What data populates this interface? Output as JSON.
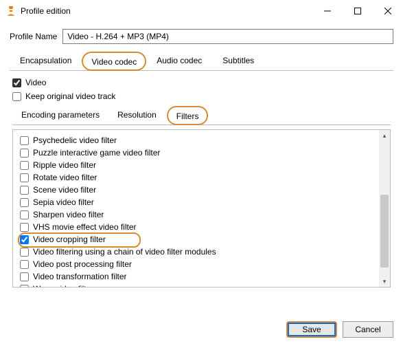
{
  "window": {
    "title": "Profile edition"
  },
  "profile": {
    "label": "Profile Name",
    "value": "Video - H.264 + MP3 (MP4)"
  },
  "tabs": {
    "encapsulation": "Encapsulation",
    "video_codec": "Video codec",
    "audio_codec": "Audio codec",
    "subtitles": "Subtitles"
  },
  "video": {
    "video_checkbox": "Video",
    "keep_original": "Keep original video track"
  },
  "subtabs": {
    "encoding": "Encoding parameters",
    "resolution": "Resolution",
    "filters": "Filters"
  },
  "filters": [
    {
      "label": "Psychedelic video filter",
      "checked": false
    },
    {
      "label": "Puzzle interactive game video filter",
      "checked": false
    },
    {
      "label": "Ripple video filter",
      "checked": false
    },
    {
      "label": "Rotate video filter",
      "checked": false
    },
    {
      "label": "Scene video filter",
      "checked": false
    },
    {
      "label": "Sepia video filter",
      "checked": false
    },
    {
      "label": "Sharpen video filter",
      "checked": false
    },
    {
      "label": "VHS movie effect video filter",
      "checked": false
    },
    {
      "label": "Video cropping filter",
      "checked": true,
      "highlighted": true
    },
    {
      "label": "Video filtering using a chain of video filter modules",
      "checked": false
    },
    {
      "label": "Video post processing filter",
      "checked": false
    },
    {
      "label": "Video transformation filter",
      "checked": false
    },
    {
      "label": "Wave video filter",
      "checked": false
    }
  ],
  "buttons": {
    "save": "Save",
    "cancel": "Cancel"
  }
}
